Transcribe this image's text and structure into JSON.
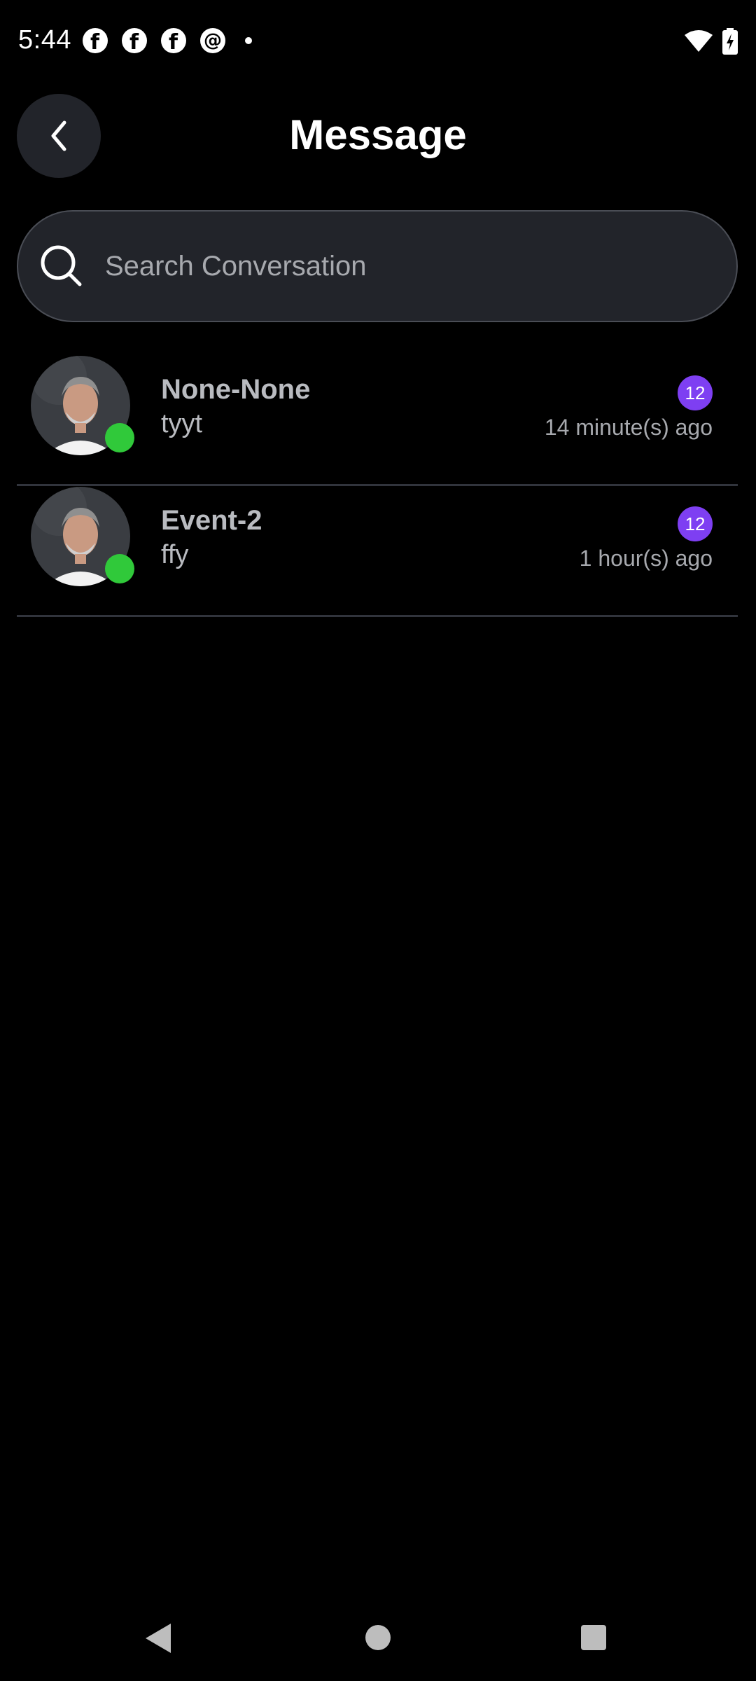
{
  "status_bar": {
    "time": "5:44",
    "left_icons": [
      "facebook-icon",
      "facebook-icon",
      "facebook-icon",
      "threads-icon",
      "notification-dot"
    ],
    "right_icons": [
      "wifi-icon",
      "battery-charging-icon"
    ]
  },
  "header": {
    "title": "Message",
    "back_icon": "chevron-left-icon"
  },
  "search": {
    "placeholder": "Search Conversation",
    "icon": "search-icon"
  },
  "conversations": [
    {
      "name": "None-None",
      "last_message": "tyyt",
      "time": "14 minute(s) ago",
      "unread_count": "12",
      "online": true
    },
    {
      "name": "Event-2",
      "last_message": "ffy",
      "time": "1 hour(s) ago",
      "unread_count": "12",
      "online": true
    }
  ],
  "colors": {
    "background": "#000000",
    "surface": "#22242a",
    "badge": "#7e3ff2",
    "online": "#30c93a",
    "text_muted": "#b9bbc0"
  }
}
